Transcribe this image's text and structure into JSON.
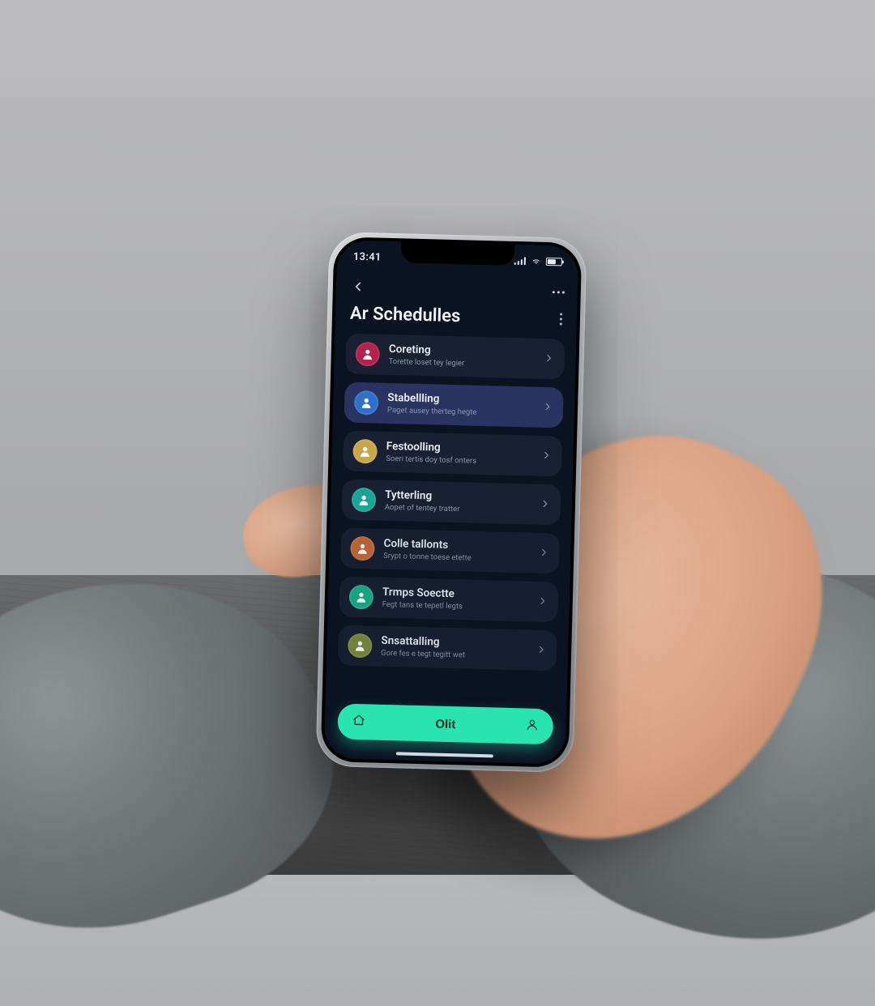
{
  "status": {
    "time": "13:41"
  },
  "header": {
    "title": "Ar Schedulles"
  },
  "list": [
    {
      "title": "Coreting",
      "subtitle": "Torette loset tey legier",
      "avatar_bg": "#b1224c",
      "selected": false
    },
    {
      "title": "Stabellling",
      "subtitle": "Paget ausey therteg hegte",
      "avatar_bg": "#2f70c9",
      "selected": true
    },
    {
      "title": "Festoolling",
      "subtitle": "Soeri tertis doy tosf onters",
      "avatar_bg": "#caa64a",
      "selected": false
    },
    {
      "title": "Tytterling",
      "subtitle": "Aopet of tentey tratter",
      "avatar_bg": "#1aa497",
      "selected": false
    },
    {
      "title": "Colle tallonts",
      "subtitle": "Srypt o tonne toese etette",
      "avatar_bg": "#c56b3a",
      "selected": false
    },
    {
      "title": "Trmps Soectte",
      "subtitle": "Fegt tans te tepetl legts",
      "avatar_bg": "#1cae8c",
      "selected": false
    },
    {
      "title": "Snsattalling",
      "subtitle": "Gore fes e tegt tegitt wet",
      "avatar_bg": "#7d8a3d",
      "selected": false
    }
  ],
  "cta": {
    "label": "Olit"
  }
}
